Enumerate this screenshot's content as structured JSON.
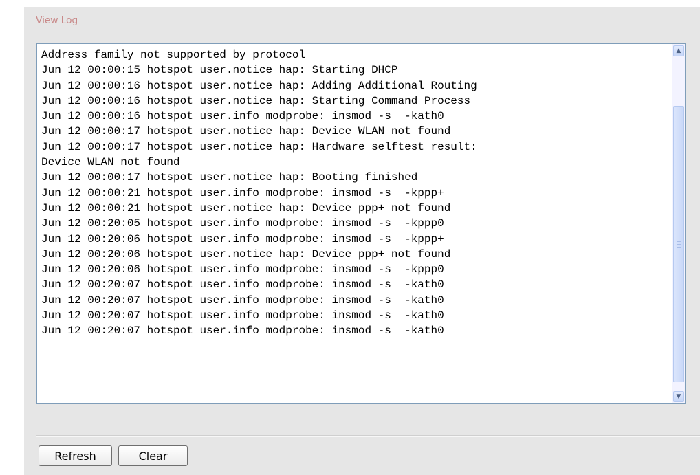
{
  "section": {
    "title": "View Log"
  },
  "log": {
    "lines": [
      "Address family not supported by protocol",
      "Jun 12 00:00:15 hotspot user.notice hap: Starting DHCP",
      "Jun 12 00:00:16 hotspot user.notice hap: Adding Additional Routing",
      "Jun 12 00:00:16 hotspot user.notice hap: Starting Command Process",
      "Jun 12 00:00:16 hotspot user.info modprobe: insmod -s  -kath0",
      "Jun 12 00:00:17 hotspot user.notice hap: Device WLAN not found",
      "Jun 12 00:00:17 hotspot user.notice hap: Hardware selftest result:",
      "Device WLAN not found",
      "Jun 12 00:00:17 hotspot user.notice hap: Booting finished",
      "Jun 12 00:00:21 hotspot user.info modprobe: insmod -s  -kppp+",
      "Jun 12 00:00:21 hotspot user.notice hap: Device ppp+ not found",
      "Jun 12 00:20:05 hotspot user.info modprobe: insmod -s  -kppp0",
      "Jun 12 00:20:06 hotspot user.info modprobe: insmod -s  -kppp+",
      "Jun 12 00:20:06 hotspot user.notice hap: Device ppp+ not found",
      "Jun 12 00:20:06 hotspot user.info modprobe: insmod -s  -kppp0",
      "Jun 12 00:20:07 hotspot user.info modprobe: insmod -s  -kath0",
      "Jun 12 00:20:07 hotspot user.info modprobe: insmod -s  -kath0",
      "Jun 12 00:20:07 hotspot user.info modprobe: insmod -s  -kath0",
      "Jun 12 00:20:07 hotspot user.info modprobe: insmod -s  -kath0"
    ]
  },
  "scrollbar": {
    "up_icon": "scroll-up-arrow-icon",
    "down_icon": "scroll-down-arrow-icon",
    "up_glyph": "▲",
    "down_glyph": "▼"
  },
  "buttons": {
    "refresh_label": "Refresh",
    "clear_label": "Clear"
  },
  "colors": {
    "section_title": "#c98a8a",
    "panel_background": "#e6e6e6",
    "log_border": "#7f9db9"
  }
}
